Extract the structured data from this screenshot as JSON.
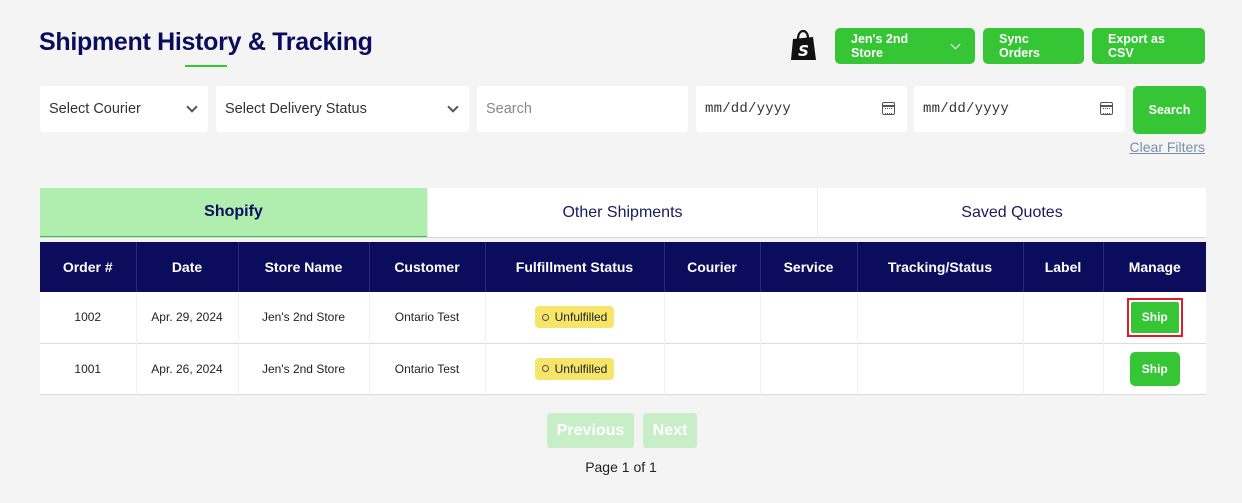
{
  "page": {
    "title": "Shipment History & Tracking"
  },
  "header": {
    "store_selector": "Jen's 2nd Store",
    "sync_label": "Sync Orders",
    "export_label": "Export as CSV"
  },
  "filters": {
    "courier": "Select Courier",
    "delivery_status": "Select Delivery Status",
    "search_placeholder": "Search",
    "date_from": "mm/dd/yyyy",
    "date_to": "mm/dd/yyyy",
    "search_button": "Search",
    "clear_filters": "Clear Filters"
  },
  "tabs": [
    {
      "label": "Shopify",
      "active": true
    },
    {
      "label": "Other Shipments",
      "active": false
    },
    {
      "label": "Saved Quotes",
      "active": false
    }
  ],
  "table": {
    "columns": [
      "Order #",
      "Date",
      "Store Name",
      "Customer",
      "Fulfillment Status",
      "Courier",
      "Service",
      "Tracking/Status",
      "Label",
      "Manage"
    ],
    "rows": [
      {
        "order": "1002",
        "date": "Apr. 29, 2024",
        "store": "Jen's 2nd Store",
        "customer": "Ontario Test",
        "status": "Unfulfilled",
        "courier": "",
        "service": "",
        "tracking": "",
        "label": "",
        "action": "Ship"
      },
      {
        "order": "1001",
        "date": "Apr. 26, 2024",
        "store": "Jen's 2nd Store",
        "customer": "Ontario Test",
        "status": "Unfulfilled",
        "courier": "",
        "service": "",
        "tracking": "",
        "label": "",
        "action": "Ship"
      }
    ]
  },
  "pagination": {
    "previous": "Previous",
    "next": "Next",
    "info": "Page 1 of 1"
  },
  "colors": {
    "accent_green": "#35c535",
    "navy": "#0c0c5c",
    "badge_yellow": "#f7e56a",
    "highlight_red": "#e01b2b"
  },
  "icons": {
    "shopify": "shopify-bag-icon",
    "dropdown": "chevron-down-icon",
    "calendar": "calendar-icon"
  }
}
